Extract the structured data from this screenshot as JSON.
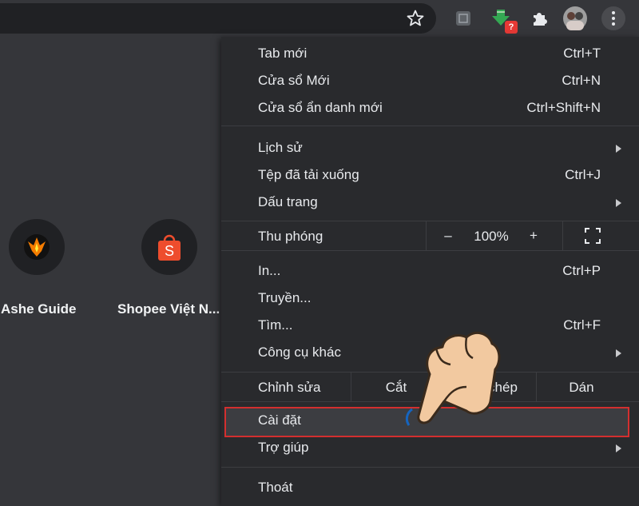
{
  "toolbar": {
    "star_icon": "star-icon",
    "extensions": [
      "tab-icon",
      "download-extension-icon",
      "puzzle-icon",
      "profile-avatar",
      "kebab-menu-icon"
    ],
    "badge_text": "?"
  },
  "shortcuts": [
    {
      "label": "Ashe Guide",
      "icon": "ashe-guide-logo"
    },
    {
      "label": "Shopee Việt N...",
      "icon": "shopee-bag-icon",
      "icon_letter": "S",
      "color": "#ee4d2d"
    }
  ],
  "menu": {
    "group1": [
      {
        "label": "Tab mới",
        "shortcut": "Ctrl+T"
      },
      {
        "label": "Cửa sổ Mới",
        "shortcut": "Ctrl+N"
      },
      {
        "label": "Cửa sổ ẩn danh mới",
        "shortcut": "Ctrl+Shift+N"
      }
    ],
    "group2": [
      {
        "label": "Lịch sử",
        "shortcut": ""
      },
      {
        "label": "Tệp đã tải xuống",
        "shortcut": "Ctrl+J"
      },
      {
        "label": "Dấu trang",
        "shortcut": ""
      }
    ],
    "zoom": {
      "label": "Thu phóng",
      "minus": "–",
      "value": "100%",
      "plus": "+"
    },
    "group3": [
      {
        "label": "In...",
        "shortcut": "Ctrl+P"
      },
      {
        "label": "Truyền...",
        "shortcut": ""
      },
      {
        "label": "Tìm...",
        "shortcut": "Ctrl+F"
      },
      {
        "label": "Công cụ khác",
        "shortcut": ""
      }
    ],
    "edit": {
      "label": "Chỉnh sửa",
      "cut": "Cắt",
      "copy": "Sao chép",
      "paste": "Dán"
    },
    "settings": {
      "label": "Cài đặt"
    },
    "help": {
      "label": "Trợ giúp"
    },
    "exit": {
      "label": "Thoát"
    }
  },
  "colors": {
    "highlight_border": "#d32f2f",
    "menu_bg": "#292a2d"
  }
}
